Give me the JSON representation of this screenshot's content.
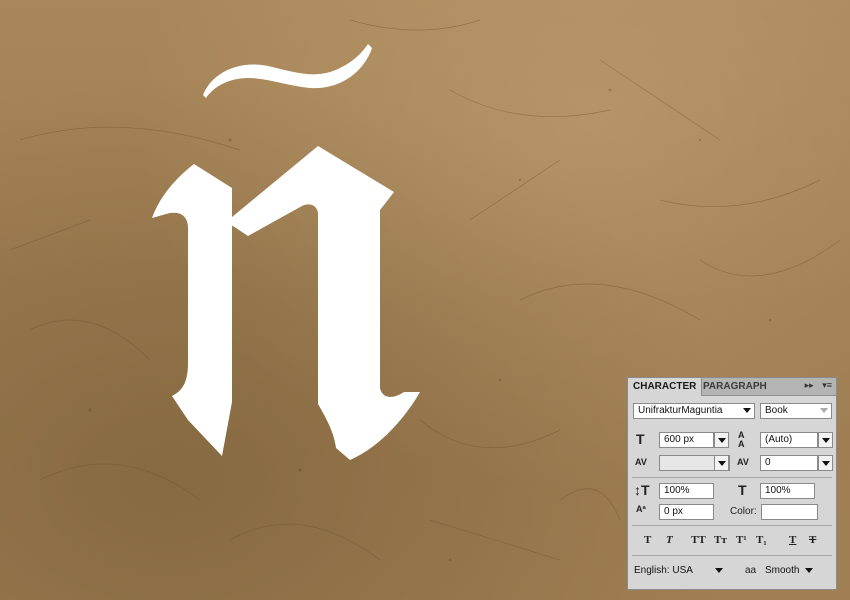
{
  "colors": {
    "background": "#a5845a",
    "glyph": "#ffffff",
    "panel": "#d6d6d6"
  },
  "artwork": {
    "glyph": "ñ"
  },
  "panel": {
    "tabs": [
      {
        "label": "CHARACTER",
        "active": true
      },
      {
        "label": "PARAGRAPH",
        "active": false
      }
    ],
    "font_family": "UnifrakturMaguntia",
    "font_style": "Book",
    "font_size": "600 px",
    "leading": "(Auto)",
    "kerning": "",
    "tracking": "0",
    "vertical_scale": "100%",
    "horizontal_scale": "100%",
    "baseline_shift": "0 px",
    "color_label": "Color:",
    "style_buttons": [
      "T",
      "T",
      "TT",
      "Tт",
      "T¹",
      "T₁",
      "T",
      "T"
    ],
    "language": "English: USA",
    "aa_icon_text": "aa",
    "antialias": "Smooth",
    "icons": {
      "size": "font-size-icon",
      "leading": "leading-icon",
      "kerning": "kerning-icon",
      "tracking": "tracking-icon",
      "vscale": "vertical-scale-icon",
      "hscale": "horizontal-scale-icon",
      "baseline": "baseline-shift-icon",
      "aa": "antialias-icon"
    }
  }
}
